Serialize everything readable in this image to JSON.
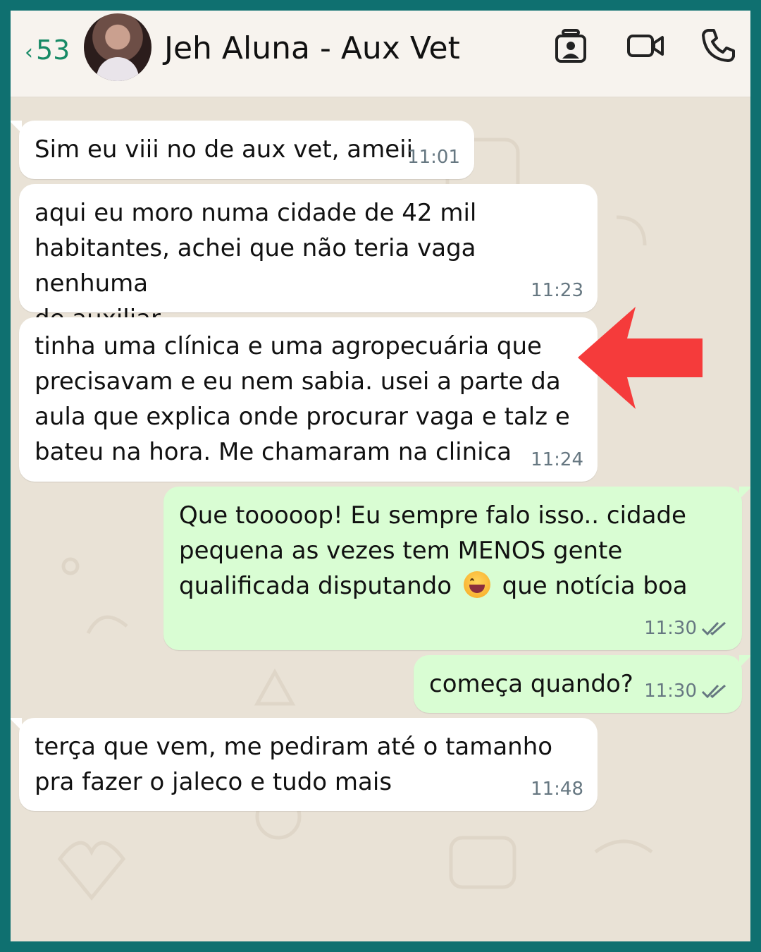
{
  "header": {
    "back_count": "53",
    "contact_name": "Jeh Aluna - Aux Vet",
    "icons": [
      "contact-card-icon",
      "video-call-icon",
      "voice-call-icon"
    ]
  },
  "messages": [
    {
      "direction": "in",
      "text": "Sim eu viii no de aux vet, ameii",
      "time": "11:01"
    },
    {
      "direction": "in",
      "text": "aqui eu moro numa cidade de 42 mil\nhabitantes, achei que não teria vaga nenhuma\nde auxiliar",
      "time": "11:23"
    },
    {
      "direction": "in",
      "text": "tinha uma clínica e uma agropecuária que\nprecisavam e eu nem sabia. usei a parte da\naula que explica onde procurar vaga e talz e\nbateu na hora. Me chamaram na clinica",
      "time": "11:24"
    },
    {
      "direction": "out",
      "text_line1": "Que tooooop! Eu sempre falo isso.. cidade",
      "text_line2": "pequena as vezes tem MENOS gente",
      "text_line3a": "qualificada disputando",
      "emoji": "grinning-face-emoji",
      "text_line3b": "que notícia boa",
      "time": "11:30",
      "status": "read"
    },
    {
      "direction": "out",
      "text": "começa quando?",
      "time": "11:30",
      "status": "read"
    },
    {
      "direction": "in",
      "text": "terça que vem, me pediram até o tamanho\npra fazer o jaleco e tudo mais",
      "time": "11:48"
    }
  ],
  "colors": {
    "frame": "#0f7070",
    "chat_background": "#e9e2d6",
    "incoming_bubble": "#ffffff",
    "outgoing_bubble": "#d9fdd3",
    "accent": "#178a66",
    "annotation_arrow": "#f53b3b"
  }
}
